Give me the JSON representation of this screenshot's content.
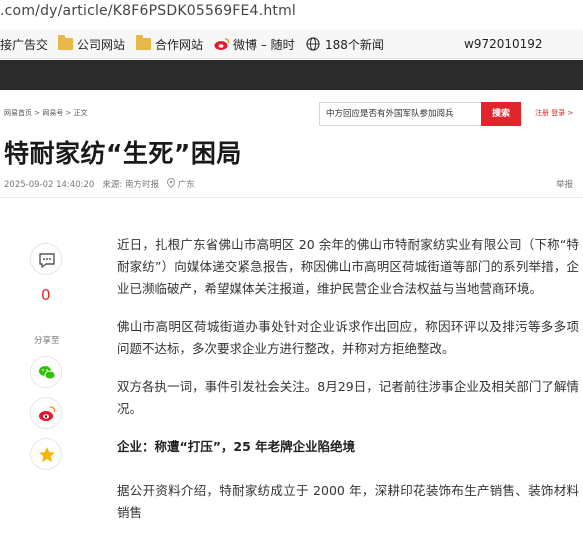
{
  "browser": {
    "url": ".com/dy/article/K8F6PSDK05569FE4.html",
    "bookmarks": [
      {
        "label": "接广告交"
      },
      {
        "label": "公司网站"
      },
      {
        "label": "合作网站"
      },
      {
        "label": "微博 – 随时"
      },
      {
        "label": "188个新闻"
      }
    ],
    "user_tag": "w972010192"
  },
  "page": {
    "breadcrumb": "网易首页 > 网易号 > 正文",
    "search_value": "中方回应是否有外国军队参加阅兵",
    "search_button": "搜索",
    "login": "注册  登录 >",
    "title": "特耐家纺“生死”困局",
    "date": "2025-09-02 14:40:20",
    "source_label": "来源:",
    "source": "南方时报",
    "location": "广东",
    "report": "举报",
    "comment_count": "0",
    "share_label": "分享至"
  },
  "article": {
    "p1": "近日，扎根广东省佛山市高明区 20 余年的佛山市特耐家纺实业有限公司（下称“特耐家纺”）向媒体递交紧急报告，称因佛山市高明区荷城街道等部门的系列举措，企业已濒临破产，希望媒体关注报道，维护民营企业合法权益与当地营商环境。",
    "p2": "佛山市高明区荷城街道办事处针对企业诉求作出回应，称因环评以及排污等多多项问题不达标，多次要求企业方进行整改，并称对方拒绝整改。",
    "p3": "双方各执一词，事件引发社会关注。8月29日，记者前往涉事企业及相关部门了解情况。",
    "h1": "企业：称遭“打压”，25 年老牌企业陷绝境",
    "p4": "据公开资料介绍，特耐家纺成立于 2000 年，深耕印花装饰布生产销售、装饰材料销售"
  }
}
